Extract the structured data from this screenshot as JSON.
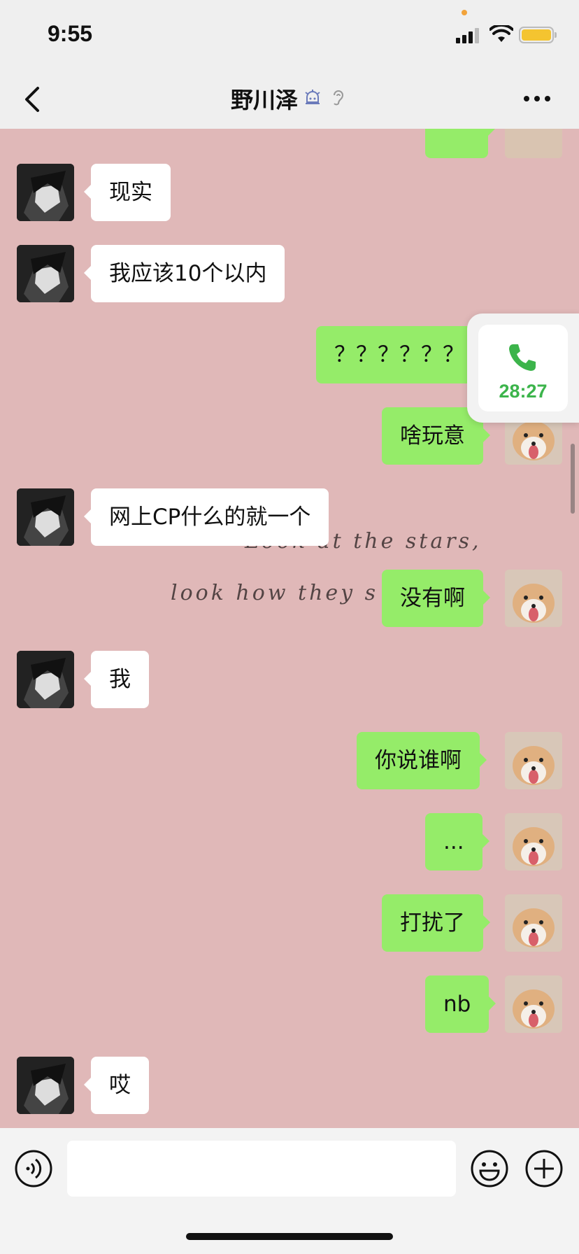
{
  "status_bar": {
    "time": "9:55"
  },
  "nav": {
    "title": "野川泽",
    "mute_icon": "notification-muted-icon",
    "ear_icon": "earpiece-mode-icon"
  },
  "chat": {
    "background_text": [
      "Look at the stars,",
      "look how they s"
    ],
    "colors": {
      "background": "#e0b8b8",
      "sent_bubble": "#95ec69",
      "received_bubble": "#ffffff"
    },
    "messages": [
      {
        "side": "left",
        "text": "现实"
      },
      {
        "side": "left",
        "text": "我应该10个以内"
      },
      {
        "side": "right",
        "text": "？？？？？？"
      },
      {
        "side": "right",
        "text": "啥玩意"
      },
      {
        "side": "left",
        "text": "网上CP什么的就一个"
      },
      {
        "side": "right",
        "text": "没有啊"
      },
      {
        "side": "left",
        "text": "我"
      },
      {
        "side": "right",
        "text": "你说谁啊"
      },
      {
        "side": "right",
        "text": "..."
      },
      {
        "side": "right",
        "text": "打扰了"
      },
      {
        "side": "right",
        "text": "nb"
      },
      {
        "side": "left",
        "text": "哎"
      }
    ]
  },
  "call_float": {
    "timer": "28:27",
    "accent": "#3cb44b"
  },
  "input_bar": {
    "placeholder": ""
  }
}
